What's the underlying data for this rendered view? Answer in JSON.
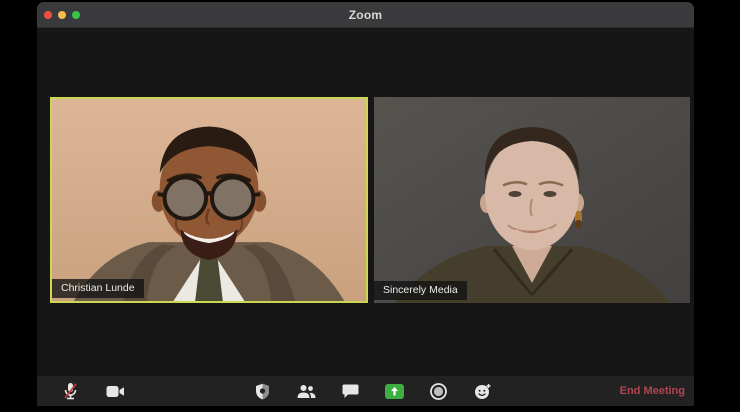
{
  "window": {
    "title": "Zoom"
  },
  "titlebar": {
    "buttons": [
      {
        "name": "close"
      },
      {
        "name": "minimize"
      },
      {
        "name": "fullscreen"
      }
    ]
  },
  "video_grid": {
    "tiles": [
      {
        "name": "Christian Lunde",
        "active_speaker": true,
        "portrait_alt": "smiling man with round glasses, tweed blazer, tan background"
      },
      {
        "name": "Sincerely Media",
        "active_speaker": false,
        "portrait_alt": "woman with buzzed hair, olive top, dark gray background"
      }
    ]
  },
  "toolbar": {
    "left_buttons": [
      {
        "icon": "microphone-muted-icon"
      },
      {
        "icon": "video-camera-icon"
      }
    ],
    "center_buttons": [
      {
        "icon": "security-shield-icon"
      },
      {
        "icon": "participants-icon"
      },
      {
        "icon": "chat-icon"
      },
      {
        "icon": "share-screen-icon"
      },
      {
        "icon": "record-icon"
      },
      {
        "icon": "reactions-icon"
      }
    ],
    "end_meeting_label": "End Meeting"
  },
  "colors": {
    "traffic_close": "#ee4f43",
    "traffic_minimize": "#f6bd4e",
    "traffic_zoom": "#37c647",
    "active_speaker_border": "#cdd852",
    "share_screen_green": "#3fae42",
    "end_meeting_red": "#b2454e",
    "mute_slash_red": "#c23b3b"
  }
}
